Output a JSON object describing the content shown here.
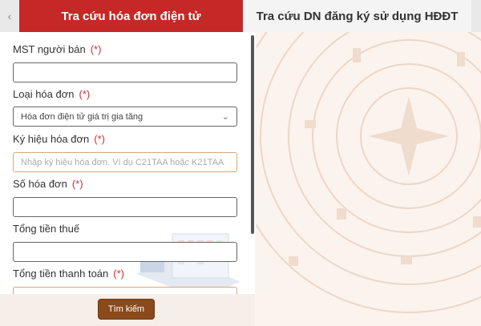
{
  "tabs": {
    "prev_arrow": "‹",
    "active": "Tra cứu hóa đơn điện tử",
    "inactive": "Tra cứu DN đăng ký sử dụng HĐĐT"
  },
  "form": {
    "seller_tax_code": {
      "label": "MST người bán",
      "required_mark": "(*)",
      "value": ""
    },
    "invoice_type": {
      "label": "Loại hóa đơn",
      "required_mark": "(*)",
      "selected": "Hóa đơn điện tử giá trị gia tăng"
    },
    "invoice_symbol": {
      "label": "Ký hiệu hóa đơn",
      "required_mark": "(*)",
      "placeholder": "Nhập ký hiệu hóa đơn. Ví dụ C21TAA hoặc K21TAA"
    },
    "invoice_number": {
      "label": "Số hóa đơn",
      "required_mark": "(*)",
      "value": ""
    },
    "total_tax": {
      "label": "Tổng tiền thuế",
      "value": ""
    },
    "total_payment": {
      "label": "Tổng tiền thanh toán",
      "required_mark": "(*)",
      "value": ""
    }
  },
  "actions": {
    "search": "Tìm kiếm"
  },
  "colors": {
    "accent": "#c62828",
    "button": "#8a4a1c",
    "required": "#d32f2f"
  }
}
